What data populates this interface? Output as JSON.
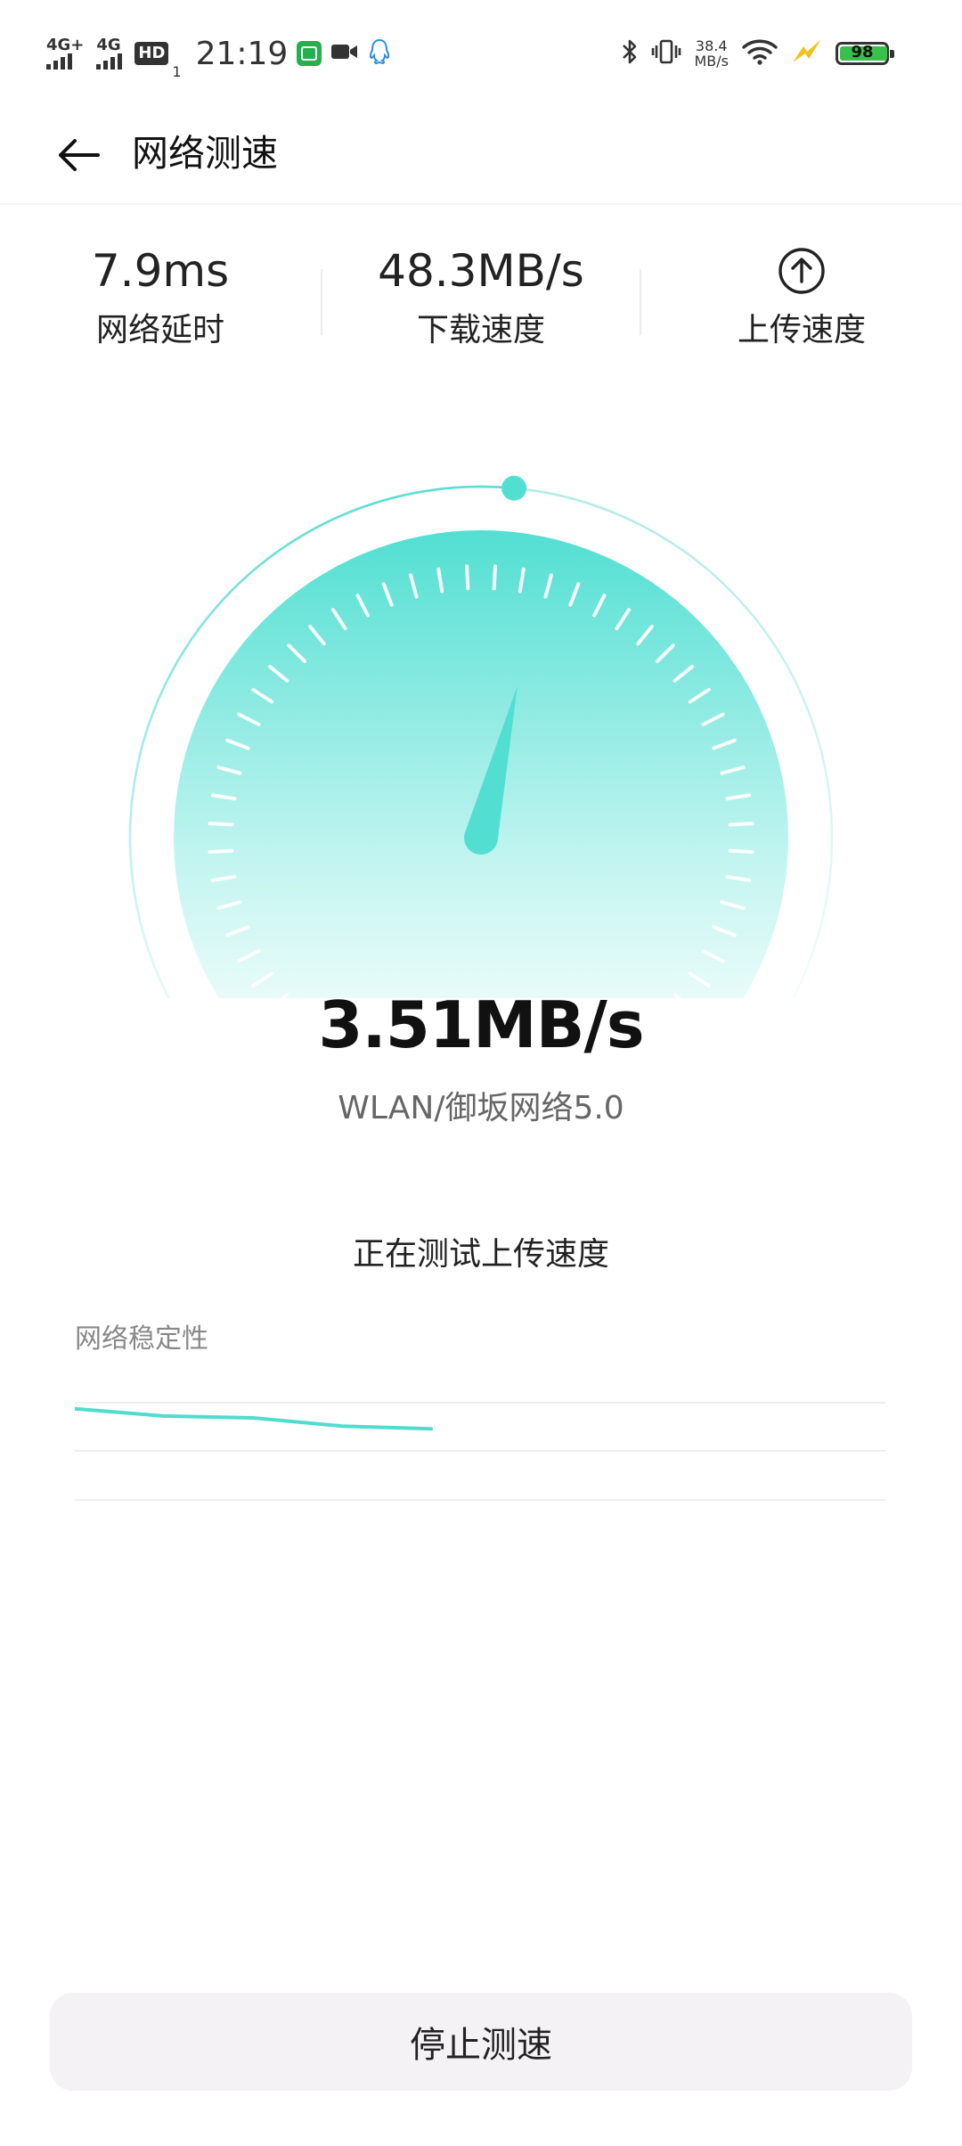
{
  "status_bar": {
    "signal1_label": "4G+",
    "signal2_label": "4G",
    "hd_label": "HD",
    "hd_sub": "1",
    "time": "21:19",
    "net_speed_value": "38.4",
    "net_speed_unit": "MB/s",
    "battery_level": "98",
    "icons": [
      "iqiyi-icon",
      "video-icon",
      "qq-icon",
      "bluetooth-icon",
      "vibrate-icon",
      "wifi-icon",
      "charging-icon",
      "battery-icon"
    ],
    "colors": {
      "iqiyi": "#22b14c",
      "qq": "#2a90d8",
      "charging": "#f2c21b",
      "battery_fill": "#36c24a"
    }
  },
  "header": {
    "title": "网络测速",
    "back_icon": "back-arrow-icon"
  },
  "stats": {
    "latency": {
      "value": "7.9ms",
      "label": "网络延时"
    },
    "download": {
      "value": "48.3MB/s",
      "label": "下载速度"
    },
    "upload": {
      "icon": "upload-arrow-icon",
      "label": "上传速度"
    }
  },
  "gauge": {
    "accent_color": "#50dccf",
    "progress": 0.52,
    "needle_fraction": 0.55,
    "tick_count": 45
  },
  "speed": {
    "value": "3.51MB/s",
    "network": "WLAN/御坂网络5.0"
  },
  "testing_status": "正在测试上传速度",
  "stability": {
    "label": "网络稳定性",
    "points": [
      1.0,
      0.84,
      0.8,
      0.62,
      0.56
    ],
    "line_color": "#50dccf"
  },
  "stop_button": {
    "label": "停止测速"
  }
}
